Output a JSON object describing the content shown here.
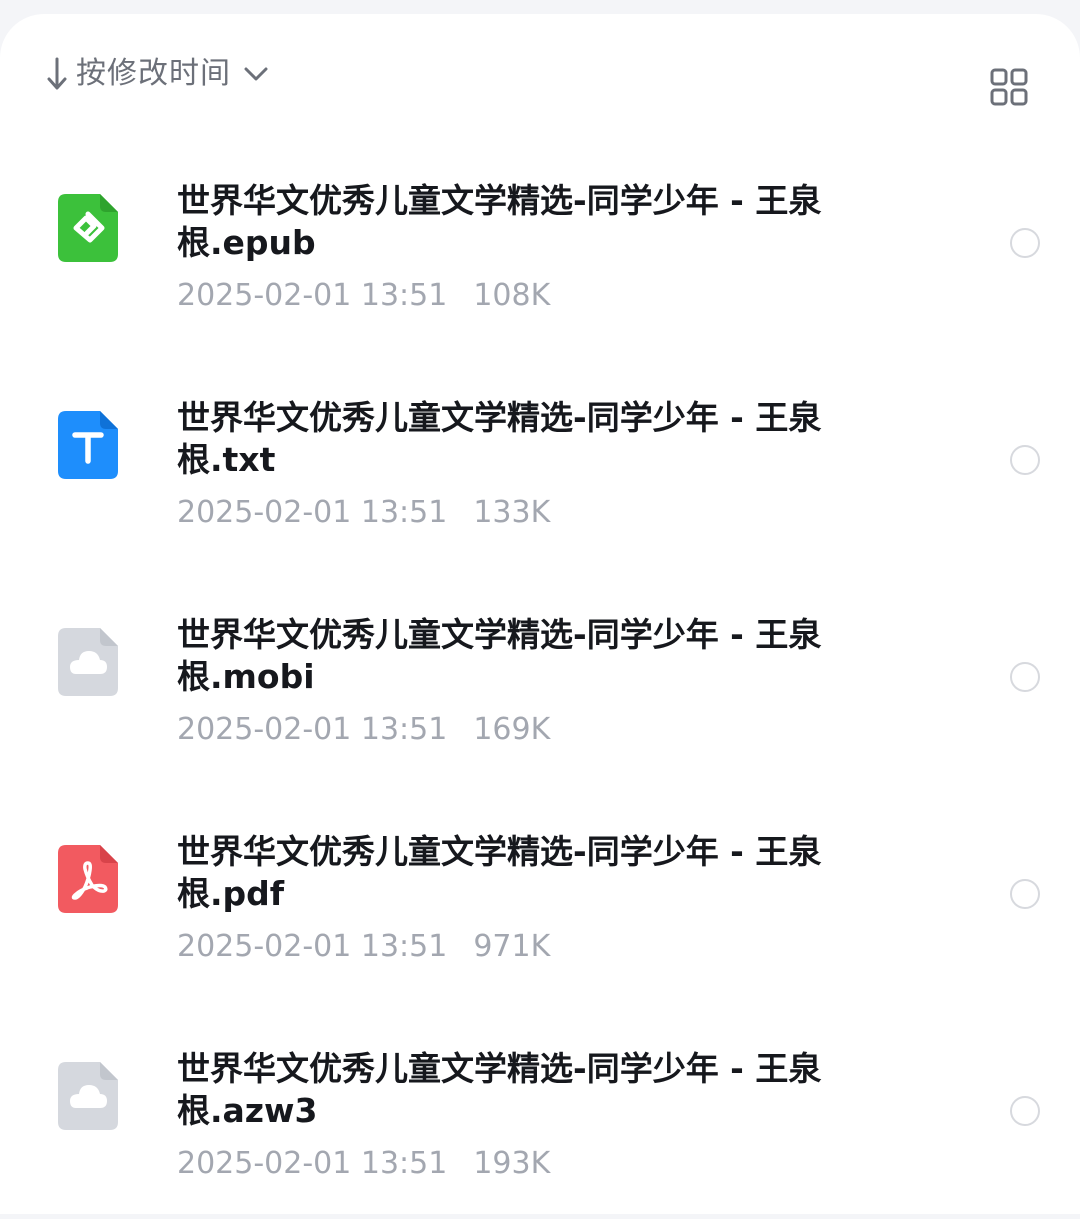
{
  "toolbar": {
    "sort_label": "按修改时间",
    "sort_icon": "arrow-down-icon",
    "dropdown_icon": "chevron-down-icon",
    "view_toggle_icon": "grid-view-icon"
  },
  "files": [
    {
      "name_line1": "世界华文优秀儿童文学精选-同学少年 - 王泉",
      "name_line2": "根.epub",
      "date": "2025-02-01 13:51",
      "size": "108K",
      "type": "epub",
      "icon": "epub-file-icon",
      "color": "#3cc13b"
    },
    {
      "name_line1": "世界华文优秀儿童文学精选-同学少年 - 王泉",
      "name_line2": "根.txt",
      "date": "2025-02-01 13:51",
      "size": "133K",
      "type": "txt",
      "icon": "txt-file-icon",
      "color": "#1e8efc"
    },
    {
      "name_line1": "世界华文优秀儿童文学精选-同学少年 - 王泉",
      "name_line2": "根.mobi",
      "date": "2025-02-01 13:51",
      "size": "169K",
      "type": "mobi",
      "icon": "cloud-file-icon",
      "color": "#d5d8de"
    },
    {
      "name_line1": "世界华文优秀儿童文学精选-同学少年 - 王泉",
      "name_line2": "根.pdf",
      "date": "2025-02-01 13:51",
      "size": "971K",
      "type": "pdf",
      "icon": "pdf-file-icon",
      "color": "#f25a60"
    },
    {
      "name_line1": "世界华文优秀儿童文学精选-同学少年 - 王泉",
      "name_line2": "根.azw3",
      "date": "2025-02-01 13:51",
      "size": "193K",
      "type": "azw3",
      "icon": "cloud-file-icon",
      "color": "#d5d8de"
    }
  ]
}
